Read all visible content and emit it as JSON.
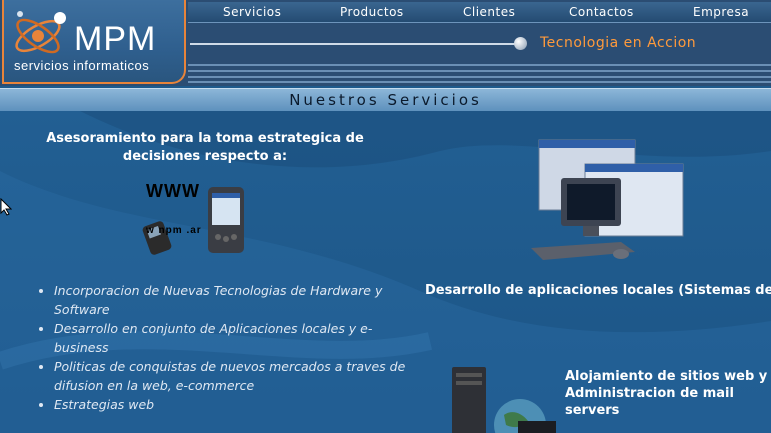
{
  "logo": {
    "name": "MPM",
    "subtitle": "servicios informaticos"
  },
  "nav": {
    "items": [
      {
        "label": "Servicios"
      },
      {
        "label": "Productos"
      },
      {
        "label": "Clientes"
      },
      {
        "label": "Contactos"
      },
      {
        "label": "Empresa"
      }
    ]
  },
  "tagline": "Tecnologia en Accion",
  "page_title": "Nuestros Servicios",
  "advice": {
    "heading": "Asesoramiento para la toma estrategica de decisiones respecto a:",
    "image_text": "WWW",
    "image_subtext": "w  npm    .ar",
    "items": [
      "Incorporacion de Nuevas Tecnologias de Hardware y Software",
      "Desarrollo en conjunto de Aplicaciones locales y e-business",
      "Politicas de conquistas de nuevos mercados a traves de difusion en la web, e-commerce",
      "Estrategias web"
    ]
  },
  "development": {
    "heading": "Desarrollo de aplicaciones locales (Sistemas de Informacion)"
  },
  "hosting": {
    "heading": "Alojamiento de sitios web y Administracion de mail servers"
  },
  "colors": {
    "accent": "#ff9a3c",
    "header_bg": "#2b4d73",
    "page_bg": "#1e5a8c",
    "title_bar": "#8cb6d8"
  }
}
